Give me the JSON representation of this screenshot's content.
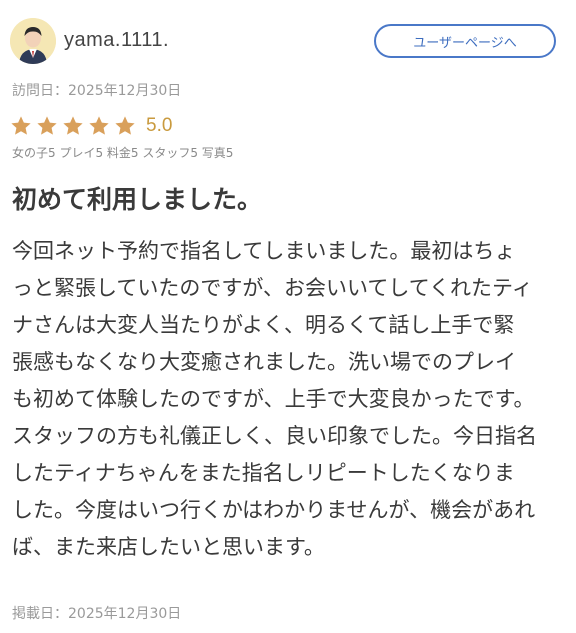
{
  "header": {
    "avatar_icon": "user-avatar-icon",
    "username": "yama.1111.",
    "user_page_button": "ユーザーページへ"
  },
  "review": {
    "visit_date": "訪問日：2025年12月30日",
    "rating": {
      "stars_filled": 5,
      "stars_total": 5,
      "star_color": "#d9a05b",
      "value": "5.0"
    },
    "sub_ratings": "女の子5 プレイ5 料金5 スタッフ5 写真5",
    "title": "初めて利用しました。",
    "body_lines": [
      "今回ネット予約で指名してしまいました。最初はちょ",
      "っと緊張していたのですが、お会いいてしてくれたティ",
      "ナさんは大変人当たりがよく、明るくて話し上手で緊",
      "張感もなくなり大変癒されました。洗い場でのプレイ",
      "も初めて体験したのですが、上手で大変良かったです。",
      "スタッフの方も礼儀正しく、良い印象でした。今日指名",
      "したティナちゃんをまた指名しリピートしたくなりま",
      "した。今度はいつ行くかはわかりませんが、機会があれ",
      "ば、また来店したいと思います。"
    ],
    "post_date": "掲載日：2025年12月30日"
  },
  "colors": {
    "accent_blue": "#4a78c8",
    "rating_gold": "#c99a3e"
  }
}
